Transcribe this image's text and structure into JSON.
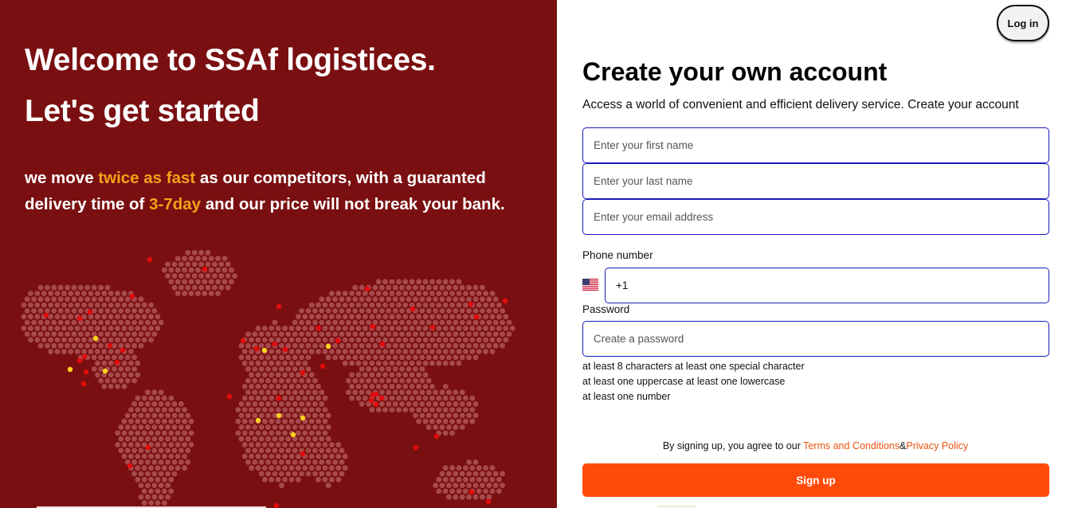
{
  "hero": {
    "title_line1": "Welcome to SSAf logistices.",
    "title_line2": "Let's get started",
    "tagline": {
      "part1": "we move ",
      "highlight1": "twice as fast",
      "part2": " as our competitors, with a guaranted delivery time of ",
      "highlight2": "3-7day",
      "part3": " and our price will not break your bank."
    },
    "map": {
      "description_icon": "world-dot-map",
      "dot_color": "#a64a4b",
      "markers_red": "#e30b0b",
      "markers_yellow": "#ffd21f"
    }
  },
  "header": {
    "login_label": "Log in"
  },
  "form": {
    "title": "Create your own account",
    "subtitle": "Access a world of convenient and efficient delivery service. Create your account",
    "first_name_placeholder": "Enter your first name",
    "last_name_placeholder": "Enter your last name",
    "email_placeholder": "Enter your email address",
    "phone_label": "Phone number",
    "phone_value": "+1",
    "phone_flag_icon": "us-flag-icon",
    "password_label": "Password",
    "password_placeholder": "Create a password",
    "password_rules": [
      "at least 8 characters at least one special character",
      "at least one uppercase at least one lowercase",
      "at least one number"
    ],
    "agree_prefix": "By signing up, you agree to our ",
    "terms_link": "Terms and Conditions",
    "agree_amp": "&",
    "privacy_link": "Privacy Policy",
    "signup_label": "Sign up"
  },
  "colors": {
    "left_bg": "#7a0f11",
    "accent": "#ff4b0a",
    "highlight": "#f6a11b",
    "input_border": "#1a1ab8"
  }
}
